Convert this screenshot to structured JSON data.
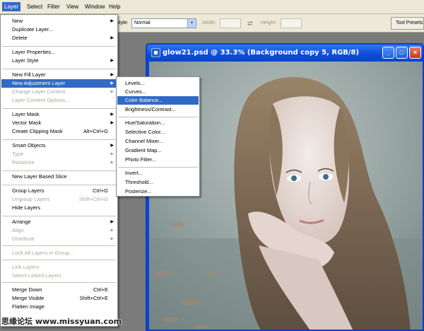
{
  "menubar": {
    "items": [
      "Layer",
      "Select",
      "Filter",
      "View",
      "Window",
      "Help"
    ],
    "active": "Layer"
  },
  "options_bar": {
    "style_label": "Style:",
    "style_value": "Normal",
    "width_label": "Width:",
    "height_label": "Height:",
    "tool_presets_tab": "Tool Presets"
  },
  "document": {
    "title": "glow21.psd @ 33.3% (Background copy 5, RGB/8)",
    "minimize_icon": "minimize-icon",
    "maximize_icon": "maximize-icon",
    "close_icon": "close-icon"
  },
  "layer_menu": {
    "items": [
      {
        "label": "New",
        "submenu": true,
        "disabled": false
      },
      {
        "label": "Duplicate Layer...",
        "disabled": false
      },
      {
        "label": "Delete",
        "submenu": true,
        "disabled": false
      },
      {
        "label": "Layer Properties...",
        "disabled": false
      },
      {
        "label": "Layer Style",
        "submenu": true,
        "disabled": false
      },
      {
        "label": "New Fill Layer",
        "submenu": true,
        "disabled": false
      },
      {
        "label": "New Adjustment Layer",
        "submenu": true,
        "disabled": false,
        "highlighted": true
      },
      {
        "label": "Change Layer Content",
        "submenu": true,
        "disabled": true
      },
      {
        "label": "Layer Content Options...",
        "disabled": true
      },
      {
        "label": "Layer Mask",
        "submenu": true,
        "disabled": false
      },
      {
        "label": "Vector Mask",
        "submenu": true,
        "disabled": false
      },
      {
        "label": "Create Clipping Mask",
        "shortcut": "Alt+Ctrl+G",
        "disabled": false
      },
      {
        "label": "Smart Objects",
        "submenu": true,
        "disabled": false
      },
      {
        "label": "Type",
        "submenu": true,
        "disabled": true
      },
      {
        "label": "Rasterize",
        "submenu": true,
        "disabled": true
      },
      {
        "label": "New Layer Based Slice",
        "disabled": false
      },
      {
        "label": "Group Layers",
        "shortcut": "Ctrl+G",
        "disabled": false
      },
      {
        "label": "Ungroup Layers",
        "shortcut": "Shift+Ctrl+G",
        "disabled": true
      },
      {
        "label": "Hide Layers",
        "disabled": false
      },
      {
        "label": "Arrange",
        "submenu": true,
        "disabled": false
      },
      {
        "label": "Align",
        "submenu": true,
        "disabled": true
      },
      {
        "label": "Distribute",
        "submenu": true,
        "disabled": true
      },
      {
        "label": "Lock All Layers in Group...",
        "disabled": true
      },
      {
        "label": "Link Layers",
        "disabled": true
      },
      {
        "label": "Select Linked Layers",
        "disabled": true
      },
      {
        "label": "Merge Down",
        "shortcut": "Ctrl+E",
        "disabled": false
      },
      {
        "label": "Merge Visible",
        "shortcut": "Shift+Ctrl+E",
        "disabled": false
      },
      {
        "label": "Flatten Image",
        "disabled": false
      }
    ]
  },
  "adjustment_submenu": {
    "items": [
      {
        "label": "Levels..."
      },
      {
        "label": "Curves..."
      },
      {
        "label": "Color Balance...",
        "highlighted": true
      },
      {
        "label": "Brightness/Contrast..."
      },
      {
        "label": "Hue/Saturation..."
      },
      {
        "label": "Selective Color..."
      },
      {
        "label": "Channel Mixer..."
      },
      {
        "label": "Gradient Map..."
      },
      {
        "label": "Photo Filter..."
      },
      {
        "label": "Invert..."
      },
      {
        "label": "Threshold..."
      },
      {
        "label": "Posterize..."
      }
    ]
  },
  "watermark": "思缘论坛 www.missyuan.com",
  "colors": {
    "menu_highlight": "#316ac5",
    "window_titlebar": "#0a46d4",
    "workspace": "#7b7b7b"
  }
}
